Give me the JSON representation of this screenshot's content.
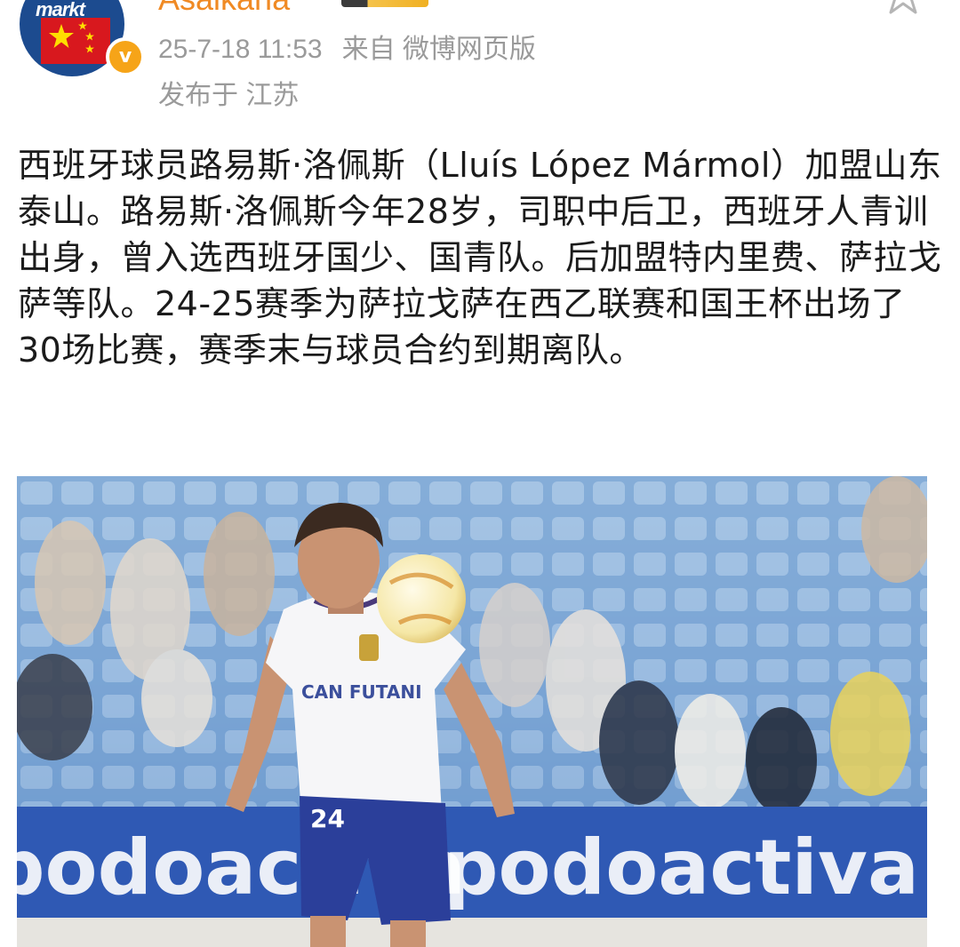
{
  "header": {
    "avatar": {
      "logo_text": "markt",
      "icon": "china-flag-icon"
    },
    "verified_icon": "verified-v-icon",
    "username": "Asaikana",
    "star_icon": "star-outline-icon",
    "timestamp": "25-7-18 11:53",
    "source": "来自 微博网页版",
    "location": "发布于 江苏"
  },
  "post": {
    "text": "西班牙球员路易斯·洛佩斯（Lluís López Mármol）加盟山东泰山。路易斯·洛佩斯今年28岁，司职中后卫，西班牙人青训出身，曾入选西班牙国少、国青队。后加盟特内里费、萨拉戈萨等队。24-25赛季为萨拉戈萨在西乙联赛和国王杯出场了30场比赛，赛季末与球员合约到期离队。"
  },
  "photo": {
    "ad_board_text": "podoactiva",
    "sponsor_text": "CAN FUTANI",
    "shorts_number": "24"
  },
  "colors": {
    "username": "#f08a24",
    "meta": "#9a9a9a",
    "verified": "#f6a418",
    "text": "#1b1b1b"
  }
}
